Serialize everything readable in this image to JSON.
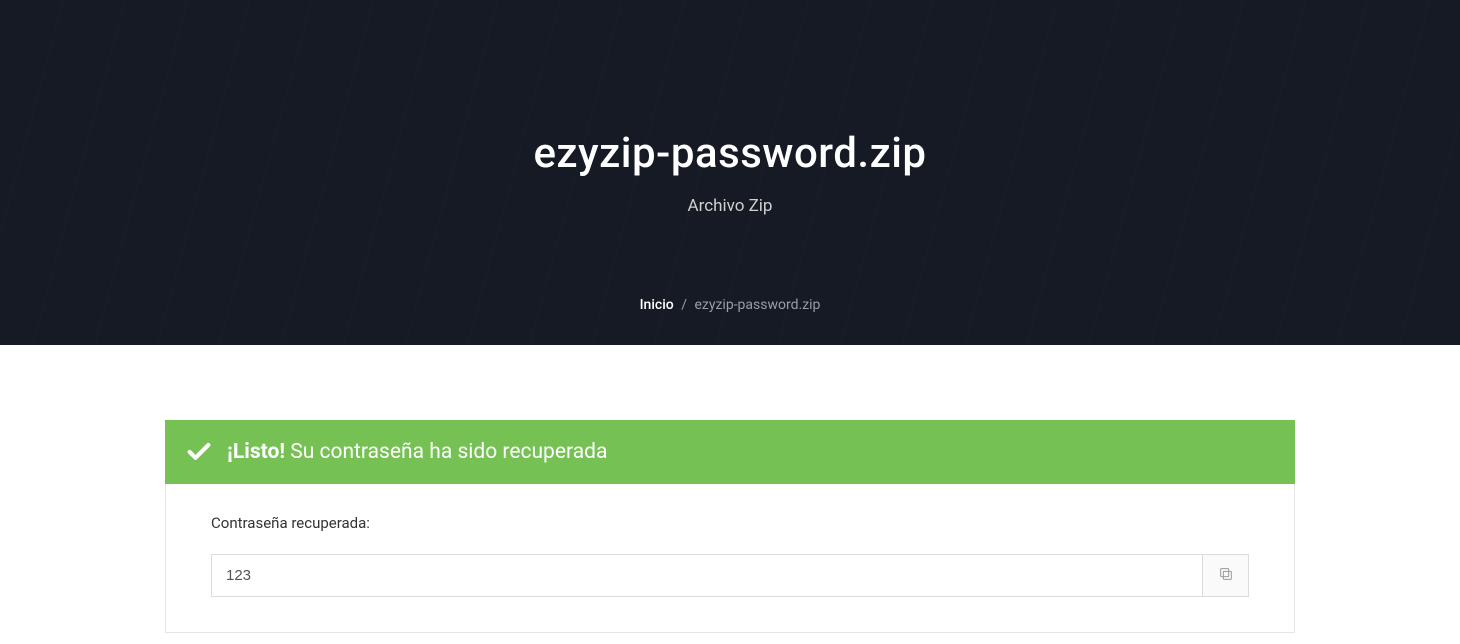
{
  "hero": {
    "title": "ezyzip-password.zip",
    "subtitle": "Archivo Zip"
  },
  "breadcrumb": {
    "home": "Inicio",
    "separator": "/",
    "current": "ezyzip-password.zip"
  },
  "alert": {
    "strong": "¡Listo!",
    "message": "Su contraseña ha sido recuperada"
  },
  "panel": {
    "label": "Contraseña recuperada:",
    "password_value": "123"
  }
}
